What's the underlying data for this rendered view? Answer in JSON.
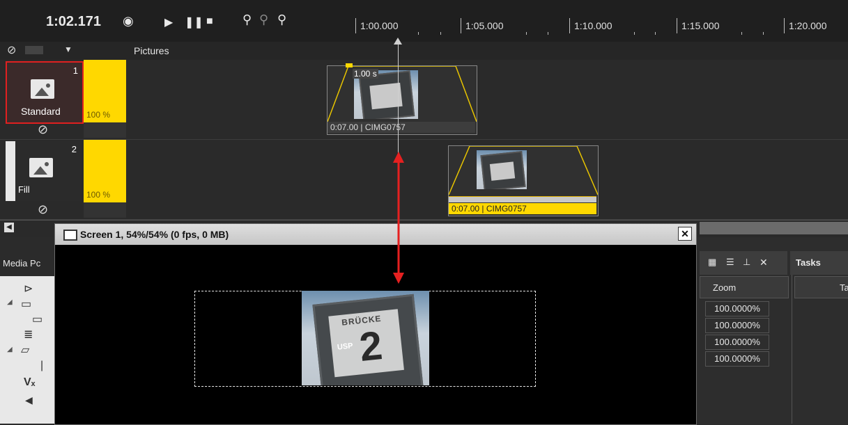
{
  "toolbar": {
    "timecode": "1:02.171",
    "icons": [
      "eye-icon",
      "play-icon",
      "pause-icon",
      "stop-icon",
      "zoom-in-icon",
      "zoom-fit-icon",
      "zoom-out-icon"
    ]
  },
  "ruler": {
    "ticks": [
      "1:00.000",
      "1:05.000",
      "1:10.000",
      "1:15.000",
      "1:20.000"
    ]
  },
  "trackbar": {
    "title": "Pictures"
  },
  "tracks": [
    {
      "number": "1",
      "mode": "Standard",
      "opacity": "100 %"
    },
    {
      "number": "2",
      "mode": "Fill",
      "opacity": "100 %"
    }
  ],
  "clips": [
    {
      "label": "0:07.00 | CIMG0757",
      "duration_badge": "1.00 s"
    },
    {
      "label": "0:07.00 | CIMG0757"
    }
  ],
  "screen": {
    "title": "Screen 1, 54%/54% (0 fps, 0 MB)",
    "close": "✕"
  },
  "sign": {
    "text": "BRÜCKE",
    "number": "2",
    "logo": "USP"
  },
  "left_panel": {
    "title": "Media Pc"
  },
  "right_panel": {
    "zoom_header": "Zoom",
    "zoom_values": [
      "100.0000%",
      "100.0000%",
      "100.0000%",
      "100.0000%"
    ],
    "tasks_title": "Tasks",
    "tasks_col": "Ta"
  },
  "colors": {
    "accent_yellow": "#ffd800",
    "selection_red": "#e02020",
    "cursor_red": "#e52020"
  }
}
